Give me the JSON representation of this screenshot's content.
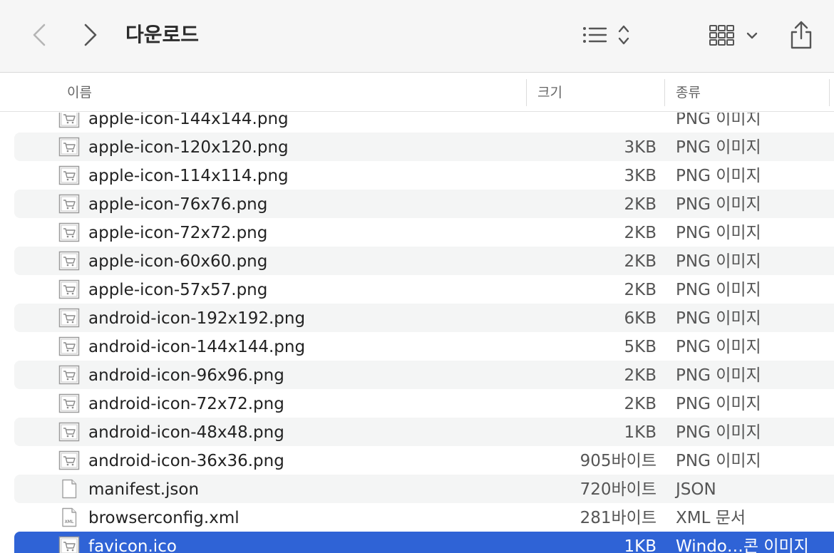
{
  "window": {
    "title": "다운로드"
  },
  "toolbar": {
    "back_icon": "chevron-left-icon",
    "forward_icon": "chevron-right-icon",
    "list_view_icon": "list-view-icon",
    "grid_view_icon": "grid-view-icon",
    "share_icon": "share-icon"
  },
  "columns": {
    "name": "이름",
    "size": "크기",
    "kind": "종류"
  },
  "colors": {
    "selection": "#2f63d6",
    "stripe": "#f4f5f5"
  },
  "files": [
    {
      "name": "apple-icon-144x144.png",
      "size": "",
      "kind": "PNG 이미지",
      "icon": "image-file-icon",
      "partial": true
    },
    {
      "name": "apple-icon-120x120.png",
      "size": "3KB",
      "kind": "PNG 이미지",
      "icon": "image-file-icon"
    },
    {
      "name": "apple-icon-114x114.png",
      "size": "3KB",
      "kind": "PNG 이미지",
      "icon": "image-file-icon"
    },
    {
      "name": "apple-icon-76x76.png",
      "size": "2KB",
      "kind": "PNG 이미지",
      "icon": "image-file-icon"
    },
    {
      "name": "apple-icon-72x72.png",
      "size": "2KB",
      "kind": "PNG 이미지",
      "icon": "image-file-icon"
    },
    {
      "name": "apple-icon-60x60.png",
      "size": "2KB",
      "kind": "PNG 이미지",
      "icon": "image-file-icon"
    },
    {
      "name": "apple-icon-57x57.png",
      "size": "2KB",
      "kind": "PNG 이미지",
      "icon": "image-file-icon"
    },
    {
      "name": "android-icon-192x192.png",
      "size": "6KB",
      "kind": "PNG 이미지",
      "icon": "image-file-icon"
    },
    {
      "name": "android-icon-144x144.png",
      "size": "5KB",
      "kind": "PNG 이미지",
      "icon": "image-file-icon"
    },
    {
      "name": "android-icon-96x96.png",
      "size": "2KB",
      "kind": "PNG 이미지",
      "icon": "image-file-icon"
    },
    {
      "name": "android-icon-72x72.png",
      "size": "2KB",
      "kind": "PNG 이미지",
      "icon": "image-file-icon"
    },
    {
      "name": "android-icon-48x48.png",
      "size": "1KB",
      "kind": "PNG 이미지",
      "icon": "image-file-icon"
    },
    {
      "name": "android-icon-36x36.png",
      "size": "905바이트",
      "kind": "PNG 이미지",
      "icon": "image-file-icon"
    },
    {
      "name": "manifest.json",
      "size": "720바이트",
      "kind": "JSON",
      "icon": "document-file-icon"
    },
    {
      "name": "browserconfig.xml",
      "size": "281바이트",
      "kind": "XML 문서",
      "icon": "xml-file-icon",
      "icon_label": "XML"
    },
    {
      "name": "favicon.ico",
      "size": "1KB",
      "kind": "Windo…콘 이미지",
      "icon": "image-file-icon",
      "selected": true
    }
  ]
}
